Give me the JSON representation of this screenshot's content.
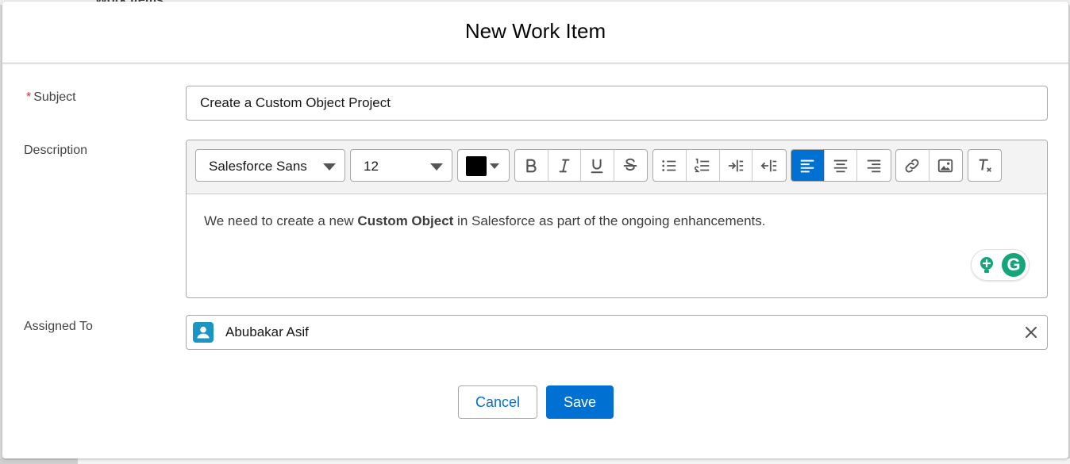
{
  "background": {
    "partial_title": "Work Items"
  },
  "modal": {
    "title": "New Work Item"
  },
  "fields": {
    "subject": {
      "required_marker": "*",
      "label": "Subject",
      "value": "Create a Custom Object Project"
    },
    "description": {
      "label": "Description",
      "toolbar": {
        "font_family": "Salesforce Sans",
        "font_size": "12",
        "text_color": "#000000"
      },
      "content": {
        "text_before": "We need to create a new ",
        "bold_text": "Custom Object",
        "text_after": " in Salesforce as part of the ongoing enhancements."
      }
    },
    "assigned_to": {
      "label": "Assigned To",
      "value": "Abubakar Asif"
    }
  },
  "grammarly": {
    "logo_letter": "G"
  },
  "footer": {
    "cancel_label": "Cancel",
    "save_label": "Save"
  },
  "colors": {
    "brand_blue": "#0070d2",
    "required_red": "#c23934",
    "avatar_blue": "#1b96c4",
    "grammarly_green": "#15a57a"
  }
}
